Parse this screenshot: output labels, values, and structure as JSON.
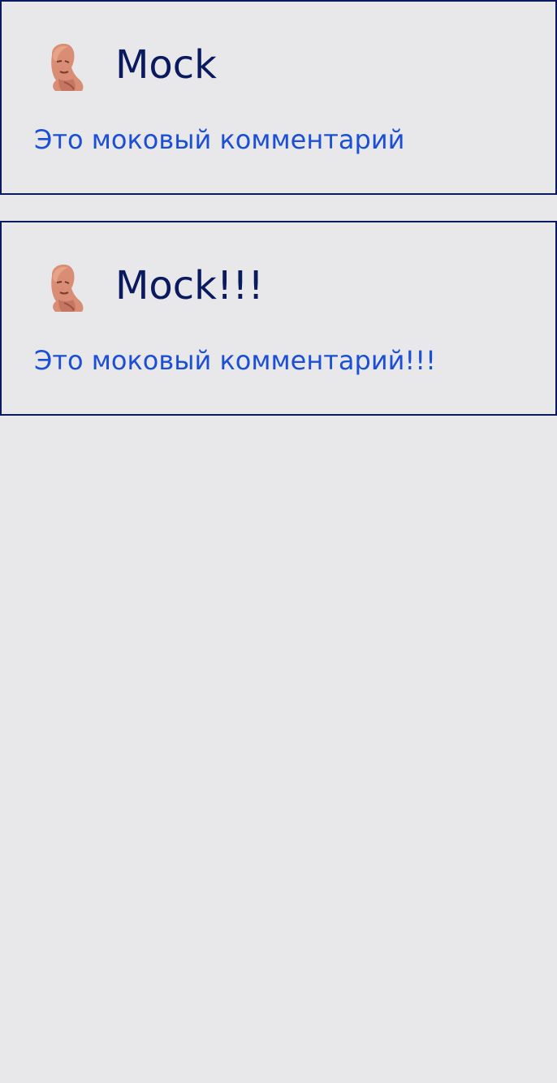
{
  "comments": [
    {
      "author": "Mock",
      "text": "Это моковый комментарий",
      "avatar_icon": "user-avatar-photo"
    },
    {
      "author": "Mock!!!",
      "text": "Это моковый комментарий!!!",
      "avatar_icon": "user-avatar-photo"
    }
  ],
  "colors": {
    "background": "#e8e7ea",
    "border": "#0a1a5e",
    "author": "#0a1a5e",
    "text": "#1a4fd6"
  }
}
